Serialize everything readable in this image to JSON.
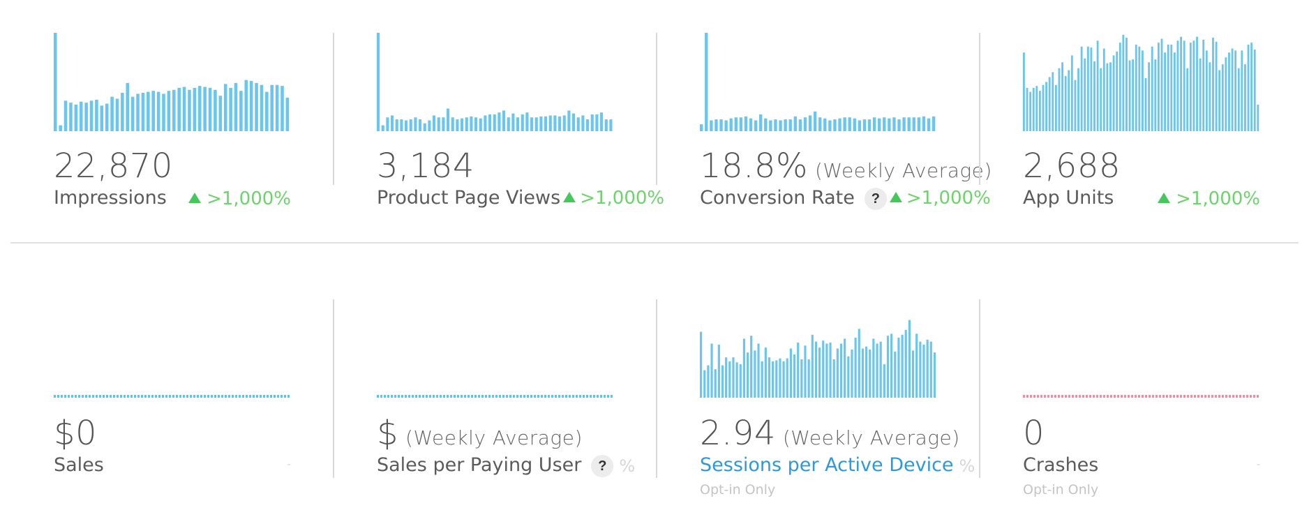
{
  "colors": {
    "bar": "#6ac6ee",
    "bar_dotted": "#5cc3ec",
    "crash_dotted": "#f28da0",
    "positive": "#45c85a",
    "link": "#2d98da"
  },
  "top_row": [
    {
      "value": "22,870",
      "label": "Impressions",
      "change": ">1,000%",
      "change_icon": "triangle-up-icon"
    },
    {
      "value": "3,184",
      "label": "Product Page Views",
      "change": ">1,000%",
      "change_icon": "triangle-up-icon"
    },
    {
      "value": "18.8%",
      "value_suffix": "(Weekly Average)",
      "label": "Conversion Rate",
      "help": "?",
      "change": ">1,000%",
      "change_icon": "triangle-up-icon"
    },
    {
      "value": "2,688",
      "label": "App Units",
      "change": ">1,000%",
      "change_icon": "triangle-up-icon"
    }
  ],
  "bottom_row": [
    {
      "value": "$0",
      "label": "Sales",
      "tail": "-"
    },
    {
      "value": "$",
      "value_suffix": "(Weekly Average)",
      "label": "Sales per Paying User",
      "help": "?",
      "tail": "%"
    },
    {
      "value": "2.94",
      "value_suffix": "(Weekly Average)",
      "label": "Sessions per Active Device",
      "tail": "%",
      "note": "Opt-in Only"
    },
    {
      "value": "0",
      "label": "Crashes",
      "tail": "-",
      "note": "Opt-in Only"
    }
  ],
  "chart_data": [
    {
      "type": "bar",
      "series": [
        {
          "values": [
            100,
            6,
            31,
            29,
            27,
            30,
            29,
            31,
            32,
            26,
            28,
            35,
            33,
            39,
            49,
            35,
            38,
            39,
            40,
            41,
            40,
            38,
            41,
            42,
            44,
            45,
            42,
            44,
            46,
            45,
            44,
            42,
            36,
            48,
            44,
            49,
            41,
            52,
            51,
            49,
            47,
            40,
            47,
            47,
            46,
            34
          ]
        }
      ],
      "ylim": [
        0,
        100
      ]
    },
    {
      "type": "bar",
      "series": [
        {
          "values": [
            100,
            6,
            14,
            16,
            12,
            12,
            11,
            12,
            14,
            12,
            8,
            11,
            16,
            14,
            14,
            23,
            14,
            12,
            13,
            14,
            15,
            14,
            13,
            16,
            17,
            17,
            19,
            21,
            14,
            18,
            14,
            17,
            19,
            14,
            14,
            15,
            15,
            16,
            16,
            15,
            16,
            21,
            18,
            14,
            16,
            12,
            17,
            17,
            19,
            12,
            12
          ]
        }
      ],
      "ylim": [
        0,
        100
      ]
    },
    {
      "type": "bar",
      "series": [
        {
          "values": [
            7,
            100,
            11,
            12,
            12,
            11,
            13,
            14,
            14,
            15,
            13,
            11,
            17,
            13,
            11,
            12,
            11,
            12,
            12,
            15,
            12,
            14,
            16,
            20,
            14,
            13,
            11,
            12,
            13,
            14,
            14,
            13,
            11,
            12,
            12,
            14,
            13,
            14,
            13,
            14,
            12,
            14,
            14,
            14,
            14,
            15,
            13,
            15
          ]
        }
      ],
      "ylim": [
        0,
        100
      ]
    },
    {
      "type": "bar",
      "series": [
        {
          "values": [
            80,
            44,
            40,
            44,
            46,
            41,
            47,
            50,
            55,
            60,
            47,
            64,
            70,
            56,
            62,
            77,
            52,
            64,
            86,
            74,
            86,
            85,
            71,
            92,
            64,
            84,
            69,
            70,
            77,
            81,
            90,
            98,
            95,
            72,
            73,
            88,
            86,
            82,
            54,
            70,
            86,
            73,
            90,
            94,
            80,
            88,
            88,
            80,
            92,
            96,
            92,
            64,
            90,
            92,
            96,
            74,
            93,
            82,
            70,
            95,
            91,
            62,
            68,
            75,
            80,
            84,
            82,
            64,
            82,
            68,
            88,
            90,
            83,
            27
          ]
        }
      ],
      "ylim": [
        0,
        100
      ]
    },
    {
      "type": "bar",
      "series": [
        {
          "values": [
            67,
            28,
            33,
            55,
            29,
            54,
            33,
            41,
            37,
            41,
            36,
            34,
            60,
            46,
            63,
            48,
            55,
            37,
            51,
            41,
            37,
            38,
            40,
            37,
            40,
            50,
            44,
            56,
            39,
            53,
            39,
            64,
            57,
            51,
            58,
            55,
            56,
            39,
            50,
            55,
            60,
            42,
            49,
            61,
            70,
            50,
            52,
            49,
            60,
            55,
            57,
            34,
            63,
            65,
            47,
            61,
            64,
            69,
            79,
            48,
            65,
            57,
            54,
            59,
            57,
            46
          ]
        }
      ],
      "ylim": [
        0,
        100
      ]
    }
  ]
}
